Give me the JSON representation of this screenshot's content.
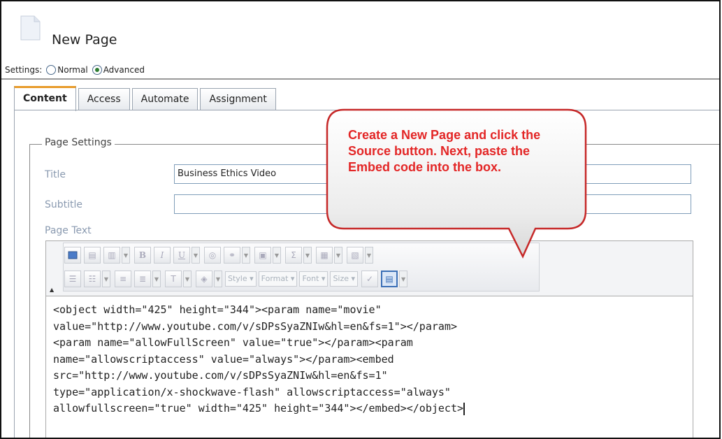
{
  "page": {
    "title": "New Page"
  },
  "settings": {
    "label": "Settings:",
    "options": [
      "Normal",
      "Advanced"
    ],
    "selected": "Advanced"
  },
  "tabs": [
    {
      "label": "Content",
      "active": true
    },
    {
      "label": "Access"
    },
    {
      "label": "Automate"
    },
    {
      "label": "Assignment"
    }
  ],
  "page_settings": {
    "legend": "Page Settings",
    "title_label": "Title",
    "title_value": "Business Ethics Video",
    "subtitle_label": "Subtitle",
    "subtitle_value": "",
    "page_text_label": "Page Text"
  },
  "toolbar": {
    "combos": [
      "Style",
      "Format",
      "Font",
      "Size"
    ],
    "icons_row1": [
      "maximize-icon",
      "paste-icon",
      "paste-text-icon",
      "bold-icon",
      "italic-icon",
      "underline-icon",
      "spellcheck-link-icon",
      "link-icon",
      "image-icon",
      "sum-icon",
      "table-icon",
      "template-icon"
    ],
    "icons_row2": [
      "numbered-list-icon",
      "bullet-list-icon",
      "align-left-icon",
      "align-center-icon",
      "text-color-icon",
      "background-color-icon",
      "spellcheck-icon",
      "source-icon"
    ]
  },
  "editor": {
    "code_lines": [
      "<object width=\"425\" height=\"344\"><param name=\"movie\"",
      "value=\"http://www.youtube.com/v/sDPsSyaZNIw&hl=en&fs=1\"></param>",
      "<param name=\"allowFullScreen\" value=\"true\"></param><param",
      "name=\"allowscriptaccess\" value=\"always\"></param><embed",
      "src=\"http://www.youtube.com/v/sDPsSyaZNIw&hl=en&fs=1\"",
      "type=\"application/x-shockwave-flash\" allowscriptaccess=\"always\"",
      "allowfullscreen=\"true\" width=\"425\" height=\"344\"></embed></object>"
    ]
  },
  "callout": {
    "text": "Create a New Page and click the Source button. Next, paste the Embed code into the box.",
    "color": "#e32626"
  }
}
